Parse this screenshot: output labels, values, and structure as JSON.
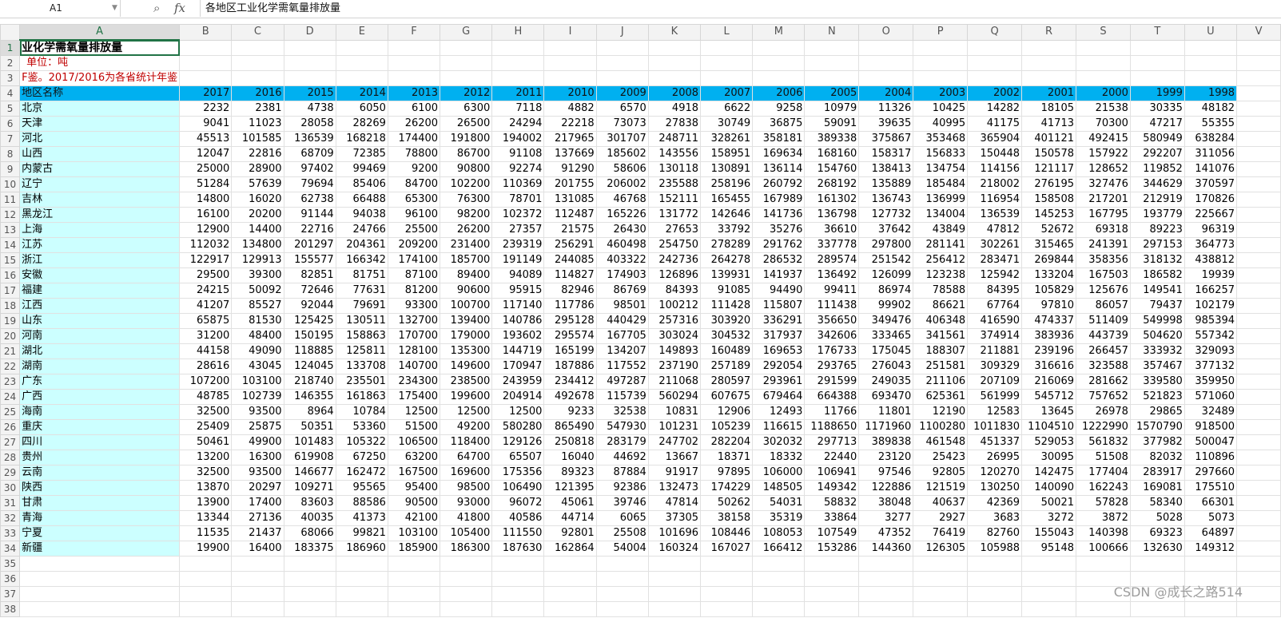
{
  "formula_bar": {
    "name_box": "A1",
    "fx_label": "fx",
    "content": "各地区工业化学需氧量排放量"
  },
  "columns": [
    "A",
    "B",
    "C",
    "D",
    "E",
    "F",
    "G",
    "H",
    "I",
    "J",
    "K",
    "L",
    "M",
    "N",
    "O",
    "P",
    "Q",
    "R",
    "S",
    "T",
    "U",
    "V"
  ],
  "row_numbers": [
    "1",
    "2",
    "3",
    "4",
    "5",
    "6",
    "7",
    "8",
    "9",
    "10",
    "11",
    "12",
    "13",
    "14",
    "15",
    "16",
    "17",
    "18",
    "19",
    "20",
    "21",
    "22",
    "23",
    "24",
    "25",
    "26",
    "27",
    "28",
    "29",
    "30",
    "31",
    "32",
    "33",
    "34",
    "35",
    "36",
    "37",
    "38"
  ],
  "sheet": {
    "title_visible": "业化学需氧量排放量",
    "unit_label": "单位：吨",
    "note_visible": "F鉴。2017/2016为各省统计年鉴",
    "header_label": "地区名称",
    "years": [
      "2017",
      "2016",
      "2015",
      "2014",
      "2013",
      "2012",
      "2011",
      "2010",
      "2009",
      "2008",
      "2007",
      "2006",
      "2005",
      "2004",
      "2003",
      "2002",
      "2001",
      "2000",
      "1999",
      "1998"
    ],
    "rows": [
      {
        "region": "北京",
        "values": [
          "2232",
          "2381",
          "4738",
          "6050",
          "6100",
          "6300",
          "7118",
          "4882",
          "6570",
          "4918",
          "6622",
          "9258",
          "10979",
          "11326",
          "10425",
          "14282",
          "18105",
          "21538",
          "30335",
          "48182"
        ]
      },
      {
        "region": "天津",
        "values": [
          "9041",
          "11023",
          "28058",
          "28269",
          "26200",
          "26500",
          "24294",
          "22218",
          "73073",
          "27838",
          "30749",
          "36875",
          "59091",
          "39635",
          "40995",
          "41175",
          "41713",
          "70300",
          "47217",
          "55355"
        ]
      },
      {
        "region": "河北",
        "values": [
          "45513",
          "101585",
          "136539",
          "168218",
          "174400",
          "191800",
          "194002",
          "217965",
          "301707",
          "248711",
          "328261",
          "358181",
          "389338",
          "375867",
          "353468",
          "365904",
          "401121",
          "492415",
          "580949",
          "638284"
        ]
      },
      {
        "region": "山西",
        "values": [
          "12047",
          "22816",
          "68709",
          "72385",
          "78800",
          "86700",
          "91108",
          "137669",
          "185602",
          "143556",
          "158951",
          "169634",
          "168160",
          "158317",
          "156833",
          "150448",
          "150578",
          "157922",
          "292207",
          "311056"
        ]
      },
      {
        "region": "内蒙古",
        "values": [
          "25000",
          "28900",
          "97402",
          "99469",
          "9200",
          "90800",
          "92274",
          "91290",
          "58606",
          "130118",
          "130891",
          "136114",
          "154760",
          "138413",
          "134754",
          "114156",
          "121117",
          "128652",
          "119852",
          "141076"
        ]
      },
      {
        "region": "辽宁",
        "values": [
          "51284",
          "57639",
          "79694",
          "85406",
          "84700",
          "102200",
          "110369",
          "201755",
          "206002",
          "235588",
          "258196",
          "260792",
          "268192",
          "135889",
          "185484",
          "218002",
          "276195",
          "327476",
          "344629",
          "370597"
        ]
      },
      {
        "region": "吉林",
        "values": [
          "14800",
          "16020",
          "62738",
          "66488",
          "65300",
          "76300",
          "78701",
          "131085",
          "46768",
          "152111",
          "165455",
          "167989",
          "161302",
          "136743",
          "136999",
          "116954",
          "158508",
          "217201",
          "212919",
          "170826"
        ]
      },
      {
        "region": "黑龙江",
        "values": [
          "16100",
          "20200",
          "91144",
          "94038",
          "96100",
          "98200",
          "102372",
          "112487",
          "165226",
          "131772",
          "142646",
          "141736",
          "136798",
          "127732",
          "134004",
          "136539",
          "145253",
          "167795",
          "193779",
          "225667"
        ]
      },
      {
        "region": "上海",
        "values": [
          "12900",
          "14400",
          "22716",
          "24766",
          "25500",
          "26200",
          "27357",
          "21575",
          "26430",
          "27653",
          "33792",
          "35276",
          "36610",
          "37642",
          "43849",
          "47812",
          "52672",
          "69318",
          "89223",
          "96319"
        ]
      },
      {
        "region": "江苏",
        "values": [
          "112032",
          "134800",
          "201297",
          "204361",
          "209200",
          "231400",
          "239319",
          "256291",
          "460498",
          "254750",
          "278289",
          "291762",
          "337778",
          "297800",
          "281141",
          "302261",
          "315465",
          "241391",
          "297153",
          "364773"
        ]
      },
      {
        "region": "浙江",
        "values": [
          "122917",
          "129913",
          "155577",
          "166342",
          "174100",
          "185700",
          "191149",
          "244085",
          "403322",
          "242736",
          "264278",
          "286532",
          "289574",
          "251542",
          "256412",
          "283471",
          "269844",
          "358356",
          "318132",
          "438812"
        ]
      },
      {
        "region": "安徽",
        "values": [
          "29500",
          "39300",
          "82851",
          "81751",
          "87100",
          "89400",
          "94089",
          "114827",
          "174903",
          "126896",
          "139931",
          "141937",
          "136492",
          "126099",
          "123238",
          "125942",
          "133204",
          "167503",
          "186582",
          "19939"
        ]
      },
      {
        "region": "福建",
        "values": [
          "24215",
          "50092",
          "72646",
          "77631",
          "81200",
          "90600",
          "95915",
          "82946",
          "86769",
          "84393",
          "91085",
          "94490",
          "99411",
          "86974",
          "78588",
          "84395",
          "105829",
          "125676",
          "149541",
          "166257"
        ]
      },
      {
        "region": "江西",
        "values": [
          "41207",
          "85527",
          "92044",
          "79691",
          "93300",
          "100700",
          "117140",
          "117786",
          "98501",
          "100212",
          "111428",
          "115807",
          "111438",
          "99902",
          "86621",
          "67764",
          "97810",
          "86057",
          "79437",
          "102179"
        ]
      },
      {
        "region": "山东",
        "values": [
          "65875",
          "81530",
          "125425",
          "130511",
          "132700",
          "139400",
          "140786",
          "295128",
          "440429",
          "257316",
          "303920",
          "336291",
          "356650",
          "349476",
          "406348",
          "416590",
          "474337",
          "511409",
          "549998",
          "985394"
        ]
      },
      {
        "region": "河南",
        "values": [
          "31200",
          "48400",
          "150195",
          "158863",
          "170700",
          "179000",
          "193602",
          "295574",
          "167705",
          "303024",
          "304532",
          "317937",
          "342606",
          "333465",
          "341561",
          "374914",
          "383936",
          "443739",
          "504620",
          "557342"
        ]
      },
      {
        "region": "湖北",
        "values": [
          "44158",
          "49090",
          "118885",
          "125811",
          "128100",
          "135300",
          "144719",
          "165199",
          "134207",
          "149893",
          "160489",
          "169653",
          "176733",
          "175045",
          "188307",
          "211881",
          "239196",
          "266457",
          "333932",
          "329093"
        ]
      },
      {
        "region": "湖南",
        "values": [
          "28616",
          "43045",
          "124045",
          "133708",
          "140700",
          "149600",
          "170947",
          "187886",
          "117552",
          "237190",
          "257189",
          "292054",
          "293765",
          "276043",
          "251581",
          "309329",
          "316616",
          "323588",
          "357467",
          "377132"
        ]
      },
      {
        "region": "广东",
        "values": [
          "107200",
          "103100",
          "218740",
          "235501",
          "234300",
          "238500",
          "243959",
          "234412",
          "497287",
          "211068",
          "280597",
          "293961",
          "291599",
          "249035",
          "211106",
          "207109",
          "216069",
          "281662",
          "339580",
          "359950"
        ]
      },
      {
        "region": "广西",
        "values": [
          "48785",
          "102739",
          "146355",
          "161863",
          "175400",
          "199600",
          "204914",
          "492678",
          "115739",
          "560294",
          "607675",
          "679464",
          "664388",
          "693470",
          "625361",
          "561999",
          "545712",
          "757652",
          "521823",
          "571060"
        ]
      },
      {
        "region": "海南",
        "values": [
          "32500",
          "93500",
          "8964",
          "10784",
          "12500",
          "12500",
          "12500",
          "9233",
          "32538",
          "10831",
          "12906",
          "12493",
          "11766",
          "11801",
          "12190",
          "12583",
          "13645",
          "26978",
          "29865",
          "32489"
        ]
      },
      {
        "region": "重庆",
        "values": [
          "25409",
          "25875",
          "50351",
          "53360",
          "51500",
          "49200",
          "580280",
          "865490",
          "547930",
          "101231",
          "105239",
          "116615",
          "1188650",
          "1171960",
          "1100280",
          "1011830",
          "1104510",
          "1222990",
          "1570790",
          "918500"
        ]
      },
      {
        "region": "四川",
        "values": [
          "50461",
          "49900",
          "101483",
          "105322",
          "106500",
          "118400",
          "129126",
          "250818",
          "283179",
          "247702",
          "282204",
          "302032",
          "297713",
          "389838",
          "461548",
          "451337",
          "529053",
          "561832",
          "377982",
          "500047"
        ]
      },
      {
        "region": "贵州",
        "values": [
          "13200",
          "16300",
          "619908",
          "67250",
          "63200",
          "64700",
          "65507",
          "16040",
          "44692",
          "13667",
          "18371",
          "18332",
          "22440",
          "23120",
          "25423",
          "26995",
          "30095",
          "51508",
          "82032",
          "110896"
        ]
      },
      {
        "region": "云南",
        "values": [
          "32500",
          "93500",
          "146677",
          "162472",
          "167500",
          "169600",
          "175356",
          "89323",
          "87884",
          "91917",
          "97895",
          "106000",
          "106941",
          "97546",
          "92805",
          "120270",
          "142475",
          "177404",
          "283917",
          "297660"
        ]
      },
      {
        "region": "陕西",
        "values": [
          "13870",
          "20297",
          "109271",
          "95565",
          "95400",
          "98500",
          "106490",
          "121395",
          "92386",
          "132473",
          "174229",
          "148505",
          "149342",
          "122886",
          "121519",
          "130250",
          "140090",
          "162243",
          "169081",
          "175510"
        ]
      },
      {
        "region": "甘肃",
        "values": [
          "13900",
          "17400",
          "83603",
          "88586",
          "90500",
          "93000",
          "96072",
          "45061",
          "39746",
          "47814",
          "50262",
          "54031",
          "58832",
          "38048",
          "40637",
          "42369",
          "50021",
          "57828",
          "58340",
          "66301"
        ]
      },
      {
        "region": "青海",
        "values": [
          "13344",
          "27136",
          "40035",
          "41373",
          "42100",
          "41800",
          "40586",
          "44714",
          "6065",
          "37305",
          "38158",
          "35319",
          "33864",
          "3277",
          "2927",
          "3683",
          "3272",
          "3872",
          "5028",
          "5073"
        ]
      },
      {
        "region": "宁夏",
        "values": [
          "11535",
          "21437",
          "68066",
          "99821",
          "103100",
          "105400",
          "111550",
          "92801",
          "25508",
          "101696",
          "108446",
          "108053",
          "107549",
          "47352",
          "76419",
          "82760",
          "155043",
          "140398",
          "69323",
          "64897"
        ]
      },
      {
        "region": "新疆",
        "values": [
          "19900",
          "16400",
          "183375",
          "186960",
          "185900",
          "186300",
          "187630",
          "162864",
          "54004",
          "160324",
          "167027",
          "166412",
          "153286",
          "144360",
          "126305",
          "105988",
          "95148",
          "100666",
          "132630",
          "149312"
        ]
      }
    ]
  },
  "watermark": "CSDN @成长之路514"
}
